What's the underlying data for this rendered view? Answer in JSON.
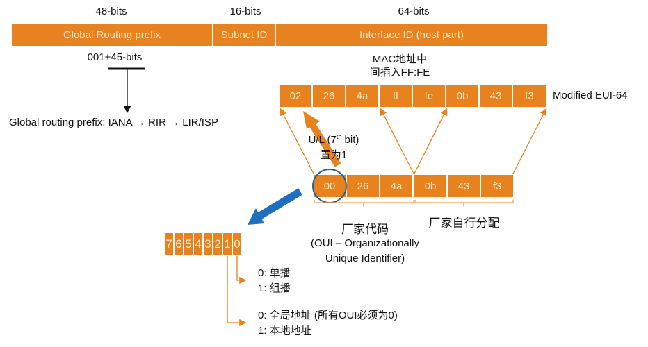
{
  "header": {
    "sizes": [
      "48-bits",
      "16-bits",
      "64-bits"
    ],
    "fields": [
      "Global Routing prefix",
      "Subnet ID",
      "Interface ID (host part)"
    ]
  },
  "prefix": {
    "note": "001+45-bits",
    "hierarchy": "Global routing prefix: IANA → RIR → LIR/ISP"
  },
  "mac_insert_note": [
    "MAC地址中",
    "间插入FF:FE"
  ],
  "eui64": {
    "label": "Modified EUI-64",
    "bytes": [
      "02",
      "26",
      "4a",
      "ff",
      "fe",
      "0b",
      "43",
      "f3"
    ]
  },
  "ul_note": {
    "line1_prefix": "U/L (7",
    "line1_sup": "th",
    "line1_suffix": " bit)",
    "line2": "置为1"
  },
  "mac": {
    "bytes": [
      "00",
      "26",
      "4a",
      "0b",
      "43",
      "f3"
    ],
    "oui_label": "厂家代码",
    "oui_desc": [
      "(OUI – Organizationally",
      "Unique Identifier)"
    ],
    "vendor_label": "厂家自行分配"
  },
  "bits": [
    "7",
    "6",
    "5",
    "4",
    "3",
    "2",
    "1",
    "0"
  ],
  "bit0_meaning": [
    "0: 单播",
    "1: 组播"
  ],
  "bit1_meaning": [
    "0: 全局地址 (所有OUI必须为0)",
    "1: 本地地址"
  ],
  "colors": {
    "orange": "#e8821e",
    "blue": "#1f6fbf",
    "circle": "#1f5f8f",
    "text_on_orange": "#fbe7cc"
  }
}
